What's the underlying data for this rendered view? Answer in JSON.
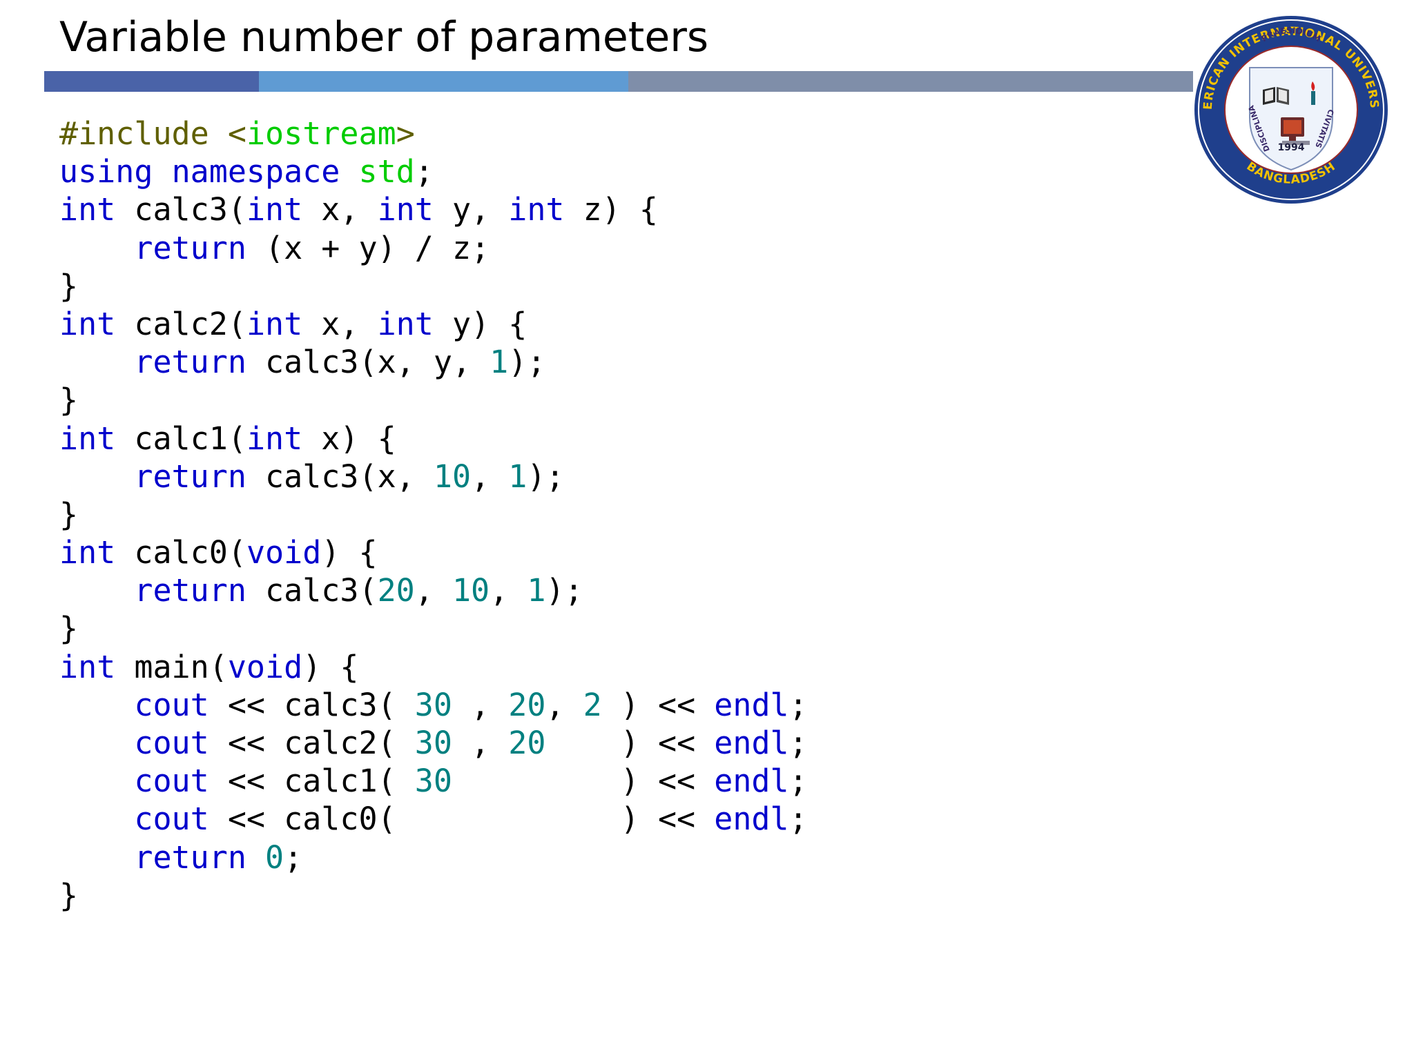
{
  "slide": {
    "title": "Variable number of parameters"
  },
  "colors": {
    "title_bar": [
      "#4a63a8",
      "#5f9bd3",
      "#7f8ea9"
    ],
    "code_default": "#000000",
    "keyword": "#0000cc",
    "preprocessor": "#5f5f00",
    "include_target": "#00cc00",
    "std_namespace": "#00cc00",
    "number": "#008080",
    "logo_ring": "#1f3f8c",
    "logo_ring_text": "#f2c200"
  },
  "logo": {
    "ring_top_text": "AMERICAN INTERNATIONAL UNIVERSITY",
    "ring_bottom_text": "BANGLADESH",
    "motto_top": "PRAESIDIUM",
    "motto_left": "DISCIPLINA",
    "motto_right": "CIVITATIS",
    "year": "1994"
  },
  "code": {
    "language": "C++",
    "lines": [
      [
        {
          "t": "#include ",
          "c": "pre"
        },
        {
          "t": "<",
          "c": "pre"
        },
        {
          "t": "iostream",
          "c": "inc"
        },
        {
          "t": ">",
          "c": "pre"
        }
      ],
      [
        {
          "t": "using",
          "c": "kw"
        },
        {
          "t": " ",
          "c": ""
        },
        {
          "t": "namespace",
          "c": "kw"
        },
        {
          "t": " ",
          "c": ""
        },
        {
          "t": "std",
          "c": "std"
        },
        {
          "t": ";",
          "c": ""
        }
      ],
      [
        {
          "t": "int",
          "c": "kw"
        },
        {
          "t": " calc3(",
          "c": ""
        },
        {
          "t": "int",
          "c": "kw"
        },
        {
          "t": " x, ",
          "c": ""
        },
        {
          "t": "int",
          "c": "kw"
        },
        {
          "t": " y, ",
          "c": ""
        },
        {
          "t": "int",
          "c": "kw"
        },
        {
          "t": " z) {",
          "c": ""
        }
      ],
      [
        {
          "t": "    ",
          "c": ""
        },
        {
          "t": "return",
          "c": "kw"
        },
        {
          "t": " (x + y) / z;",
          "c": ""
        }
      ],
      [
        {
          "t": "}",
          "c": ""
        }
      ],
      [
        {
          "t": "int",
          "c": "kw"
        },
        {
          "t": " calc2(",
          "c": ""
        },
        {
          "t": "int",
          "c": "kw"
        },
        {
          "t": " x, ",
          "c": ""
        },
        {
          "t": "int",
          "c": "kw"
        },
        {
          "t": " y) {",
          "c": ""
        }
      ],
      [
        {
          "t": "    ",
          "c": ""
        },
        {
          "t": "return",
          "c": "kw"
        },
        {
          "t": " calc3(x, y, ",
          "c": ""
        },
        {
          "t": "1",
          "c": "num"
        },
        {
          "t": ");",
          "c": ""
        }
      ],
      [
        {
          "t": "}",
          "c": ""
        }
      ],
      [
        {
          "t": "int",
          "c": "kw"
        },
        {
          "t": " calc1(",
          "c": ""
        },
        {
          "t": "int",
          "c": "kw"
        },
        {
          "t": " x) {",
          "c": ""
        }
      ],
      [
        {
          "t": "    ",
          "c": ""
        },
        {
          "t": "return",
          "c": "kw"
        },
        {
          "t": " calc3(x, ",
          "c": ""
        },
        {
          "t": "10",
          "c": "num"
        },
        {
          "t": ", ",
          "c": ""
        },
        {
          "t": "1",
          "c": "num"
        },
        {
          "t": ");",
          "c": ""
        }
      ],
      [
        {
          "t": "}",
          "c": ""
        }
      ],
      [
        {
          "t": "int",
          "c": "kw"
        },
        {
          "t": " calc0(",
          "c": ""
        },
        {
          "t": "void",
          "c": "kw"
        },
        {
          "t": ") {",
          "c": ""
        }
      ],
      [
        {
          "t": "    ",
          "c": ""
        },
        {
          "t": "return",
          "c": "kw"
        },
        {
          "t": " calc3(",
          "c": ""
        },
        {
          "t": "20",
          "c": "num"
        },
        {
          "t": ", ",
          "c": ""
        },
        {
          "t": "10",
          "c": "num"
        },
        {
          "t": ", ",
          "c": ""
        },
        {
          "t": "1",
          "c": "num"
        },
        {
          "t": ");",
          "c": ""
        }
      ],
      [
        {
          "t": "}",
          "c": ""
        }
      ],
      [
        {
          "t": "int",
          "c": "kw"
        },
        {
          "t": " main(",
          "c": ""
        },
        {
          "t": "void",
          "c": "kw"
        },
        {
          "t": ") {",
          "c": ""
        }
      ],
      [
        {
          "t": "    ",
          "c": ""
        },
        {
          "t": "cout",
          "c": "kw"
        },
        {
          "t": " << calc3( ",
          "c": ""
        },
        {
          "t": "30",
          "c": "num"
        },
        {
          "t": " , ",
          "c": ""
        },
        {
          "t": "20",
          "c": "num"
        },
        {
          "t": ", ",
          "c": ""
        },
        {
          "t": "2",
          "c": "num"
        },
        {
          "t": " ) << ",
          "c": ""
        },
        {
          "t": "endl",
          "c": "kw"
        },
        {
          "t": ";",
          "c": ""
        }
      ],
      [
        {
          "t": "    ",
          "c": ""
        },
        {
          "t": "cout",
          "c": "kw"
        },
        {
          "t": " << calc2( ",
          "c": ""
        },
        {
          "t": "30",
          "c": "num"
        },
        {
          "t": " , ",
          "c": ""
        },
        {
          "t": "20",
          "c": "num"
        },
        {
          "t": "    ) << ",
          "c": ""
        },
        {
          "t": "endl",
          "c": "kw"
        },
        {
          "t": ";",
          "c": ""
        }
      ],
      [
        {
          "t": "    ",
          "c": ""
        },
        {
          "t": "cout",
          "c": "kw"
        },
        {
          "t": " << calc1( ",
          "c": ""
        },
        {
          "t": "30",
          "c": "num"
        },
        {
          "t": "         ) << ",
          "c": ""
        },
        {
          "t": "endl",
          "c": "kw"
        },
        {
          "t": ";",
          "c": ""
        }
      ],
      [
        {
          "t": "    ",
          "c": ""
        },
        {
          "t": "cout",
          "c": "kw"
        },
        {
          "t": " << calc0(            ) << ",
          "c": ""
        },
        {
          "t": "endl",
          "c": "kw"
        },
        {
          "t": ";",
          "c": ""
        }
      ],
      [
        {
          "t": "    ",
          "c": ""
        },
        {
          "t": "return",
          "c": "kw"
        },
        {
          "t": " ",
          "c": ""
        },
        {
          "t": "0",
          "c": "num"
        },
        {
          "t": ";",
          "c": ""
        }
      ],
      [
        {
          "t": "}",
          "c": ""
        }
      ]
    ]
  }
}
